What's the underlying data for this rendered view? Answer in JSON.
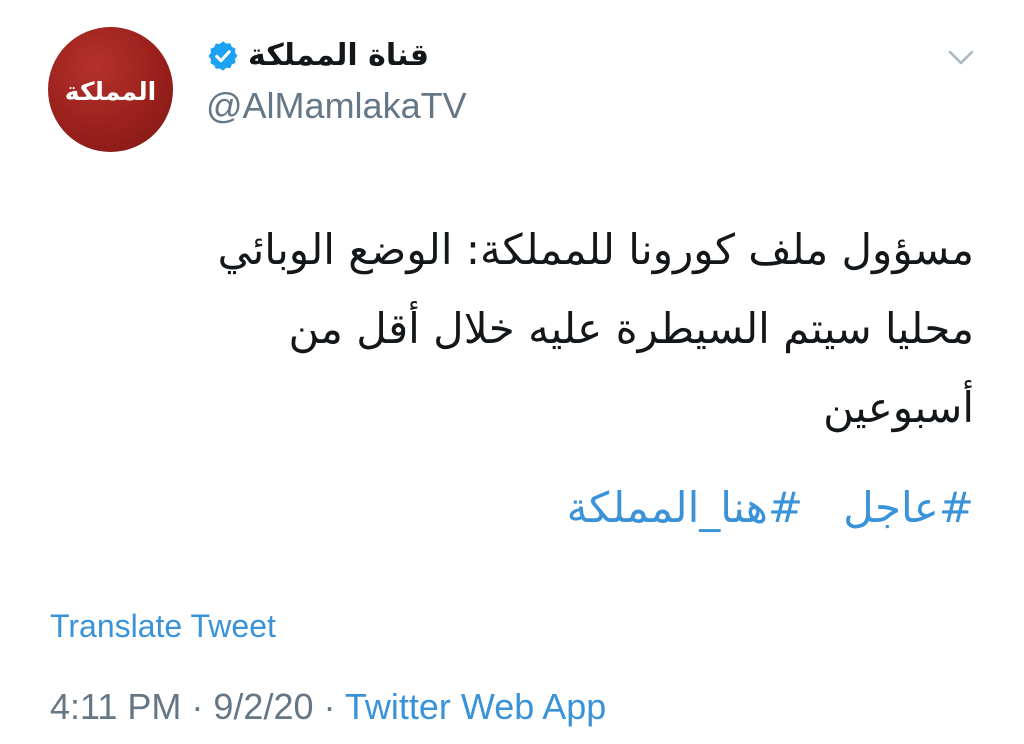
{
  "author": {
    "avatar_text": "المملكة",
    "display_name": "قناة المملكة",
    "handle": "@AlMamlakaTV",
    "verified_icon": "verified-badge-icon"
  },
  "menu": {
    "icon": "chevron-down-icon"
  },
  "tweet": {
    "lines": [
      "مسؤول ملف كورونا للمملكة: الوضع الوبائي",
      "محليا سيتم السيطرة عليه خلال أقل من",
      "أسبوعين"
    ],
    "hashtags": [
      "#عاجل",
      "#هنا_المملكة"
    ]
  },
  "translate_label": "Translate Tweet",
  "meta": {
    "time": "4:11 PM",
    "separator": " · ",
    "date": "9/2/20",
    "source": "Twitter Web App"
  },
  "colors": {
    "link": "#3a93d8",
    "text": "#14171a",
    "secondary": "#657786",
    "verified": "#1da1f2",
    "avatar": "#9a201c"
  }
}
